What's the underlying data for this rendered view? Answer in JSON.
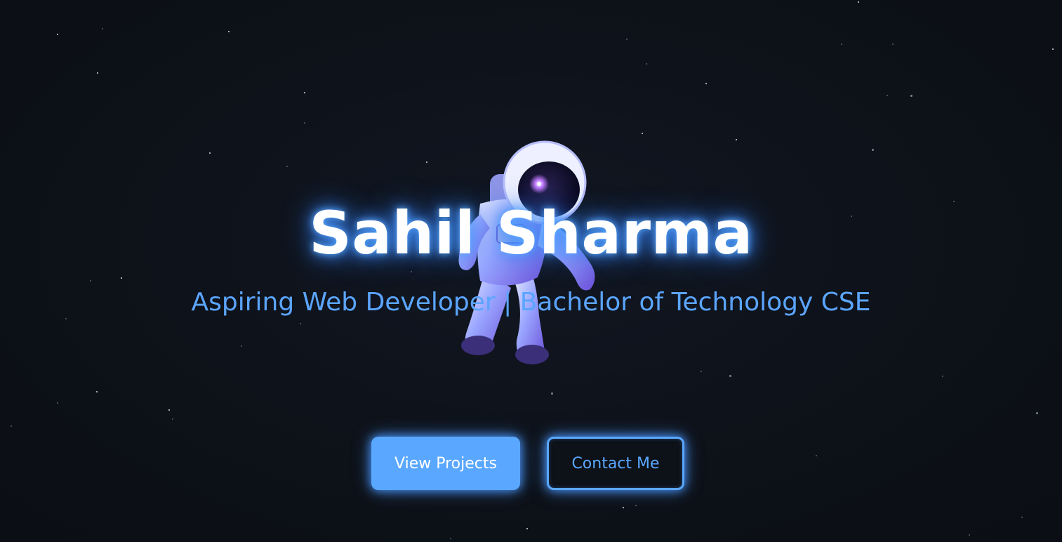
{
  "hero": {
    "name": "Sahil Sharma",
    "tagline": "Aspiring Web Developer | Bachelor of Technology CSE"
  },
  "actions": {
    "primary_label": "View Projects",
    "secondary_label": "Contact Me"
  },
  "colors": {
    "background": "#0d1118",
    "accent": "#5aa7ff",
    "glow": "#3d8cff"
  },
  "icons": {
    "hero_illustration": "astronaut-illustration"
  }
}
